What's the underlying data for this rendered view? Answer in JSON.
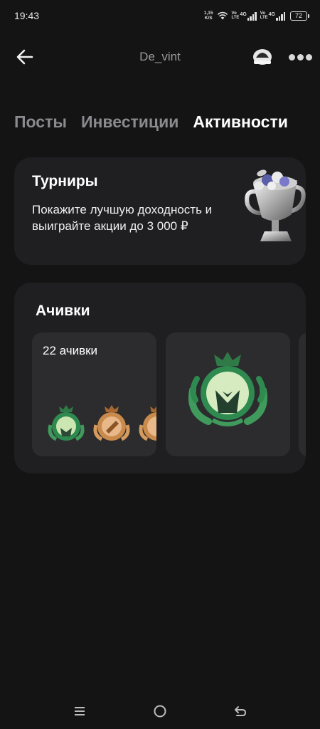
{
  "status_bar": {
    "time": "19:43",
    "net_speed_value": "1,15",
    "net_speed_unit": "K/S",
    "sim1_vo": "Vo",
    "sim1_lte": "LTE",
    "sim1_4g": "4G",
    "sim2_vo": "Vo",
    "sim2_lte": "LTE",
    "sim2_4g": "4G",
    "battery": "72"
  },
  "header": {
    "title": "De_vint",
    "back_icon": "arrow-left-icon",
    "avatar_icon": "avatar",
    "more_icon": "more-dots-icon"
  },
  "tabs": [
    {
      "label": "Посты",
      "active": false
    },
    {
      "label": "Инвестиции",
      "active": false
    },
    {
      "label": "Активности",
      "active": true
    }
  ],
  "tournaments": {
    "title": "Турниры",
    "description": "Покажите лучшую доходность и выиграйте акции до 3 000 ₽",
    "icon": "trophy-icon"
  },
  "achievements": {
    "title": "Ачивки",
    "count_label": "22 ачивки"
  },
  "colors": {
    "background": "#141414",
    "card": "#1f1f21",
    "tile": "#2c2c2e",
    "tab_inactive": "#8a8a8f",
    "medal_green": "#3f9a5c",
    "medal_bronze": "#c98a4c"
  },
  "nav_bar": {
    "recent_icon": "recent-apps-icon",
    "home_icon": "home-circle-icon",
    "back_icon": "back-icon"
  }
}
